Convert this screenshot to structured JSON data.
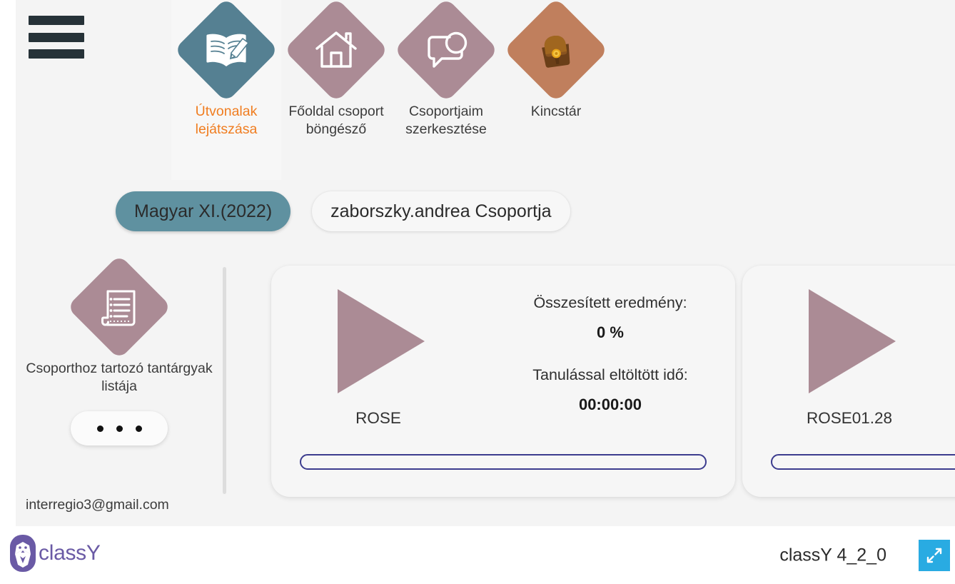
{
  "header": {
    "menu_icon": "hamburger-menu-icon",
    "nav": [
      {
        "label": "Útvonalak lejátszása",
        "icon": "book-pencil-icon",
        "active": true,
        "color": "#558092"
      },
      {
        "label": "Főoldal csoport böngésző",
        "icon": "home-icon",
        "active": false,
        "color": "#ab8b95"
      },
      {
        "label": "Csoportjaim szerkesztése",
        "icon": "chat-bubble-icon",
        "active": false,
        "color": "#ab8b95"
      },
      {
        "label": "Kincstár",
        "icon": "satchel-bag-icon",
        "active": false,
        "color": "#c07f5d"
      }
    ]
  },
  "breadcrumbs": [
    {
      "label": "Magyar XI.(2022)",
      "style": "solid"
    },
    {
      "label": "zaborszky.andrea Csoportja",
      "style": "light"
    }
  ],
  "sidebar": {
    "subject_list_icon": "document-list-icon",
    "subject_list_label": "Csoporthoz tartozó tantárgyak listája",
    "more_button": "…",
    "user_email": "interregio3@gmail.com"
  },
  "cards": [
    {
      "play_icon": "play-triangle-icon",
      "name": "ROSE",
      "result_label": "Összesített eredmény:",
      "result_value": "0 %",
      "time_label": "Tanulással eltöltött idő:",
      "time_value": "00:00:00",
      "progress_percent": 0
    },
    {
      "play_icon": "play-triangle-icon",
      "name": "ROSE01.28",
      "progress_percent": 0
    }
  ],
  "footer": {
    "logo_icon": "classy-wolf-logo-icon",
    "logo_text": "classY",
    "version": "classY 4_2_0",
    "fullscreen_icon": "fullscreen-expand-icon"
  },
  "colors": {
    "accent_orange": "#f07d20",
    "teal": "#558092",
    "mauve": "#ab8b95",
    "brown": "#c07f5d",
    "pill_teal": "#5f91a0",
    "progress_blue": "#3c3c8e",
    "fullscreen_blue": "#29abe2",
    "brand_purple": "#6a5aa5"
  }
}
